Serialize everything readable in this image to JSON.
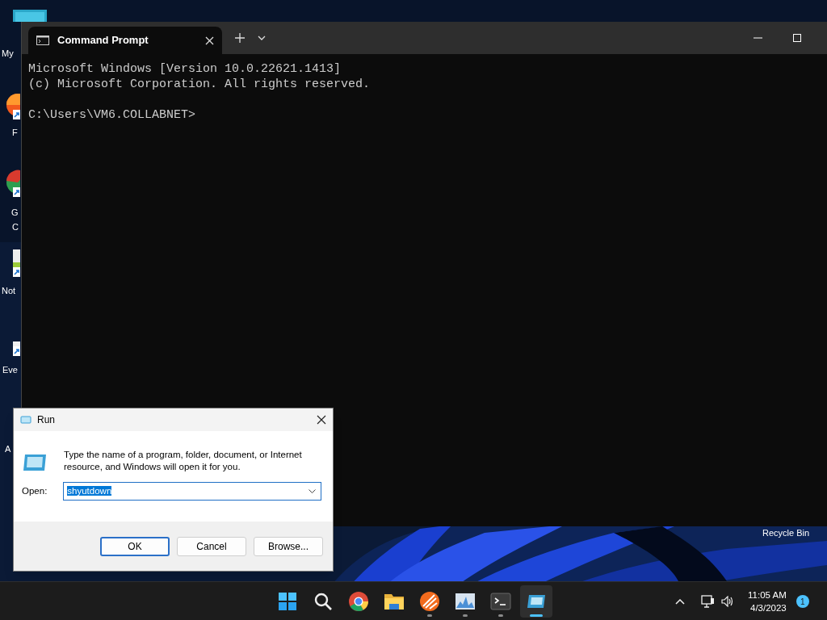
{
  "desktop_icons": [
    {
      "kind": "pc",
      "labels": [
        "My"
      ]
    },
    {
      "kind": "orange",
      "labels": [
        "F"
      ]
    },
    {
      "kind": "round",
      "labels": [
        "G",
        "C"
      ]
    },
    {
      "kind": "notepad",
      "labels": [
        "Not"
      ]
    },
    {
      "kind": "plain",
      "labels": [
        "Eve"
      ]
    },
    {
      "kind": "none",
      "labels": [
        "A"
      ]
    }
  ],
  "recycle_bin": {
    "label": "Recycle Bin"
  },
  "terminal": {
    "tabs": [
      {
        "label": "Command Prompt",
        "selected": true
      }
    ],
    "banner": [
      "Microsoft Windows [Version 10.0.22621.1413]",
      "(c) Microsoft Corporation. All rights reserved."
    ],
    "prompt": "C:\\Users\\VM6.COLLABNET>"
  },
  "run_dialog": {
    "title": "Run",
    "description": "Type the name of a program, folder, document, or Internet resource, and Windows will open it for you.",
    "open_label": "Open:",
    "open_field": {
      "value": "shyutdown",
      "text_selected": true
    },
    "buttons": [
      {
        "label": "OK",
        "default": true
      },
      {
        "label": "Cancel",
        "default": false
      },
      {
        "label": "Browse...",
        "default": false
      }
    ]
  },
  "taskbar": {
    "apps": [
      {
        "kind": "start",
        "running": false,
        "active": false
      },
      {
        "kind": "search",
        "running": false,
        "active": false
      },
      {
        "kind": "browser",
        "running": false,
        "active": false
      },
      {
        "kind": "folder",
        "running": false,
        "active": false
      },
      {
        "kind": "orange",
        "running": true,
        "active": false
      },
      {
        "kind": "monitor",
        "running": true,
        "active": false
      },
      {
        "kind": "terminal",
        "running": true,
        "active": false
      },
      {
        "kind": "run",
        "running": true,
        "active": true
      }
    ],
    "time": "11:05 AM",
    "date": "4/3/2023",
    "notifications": "1"
  }
}
